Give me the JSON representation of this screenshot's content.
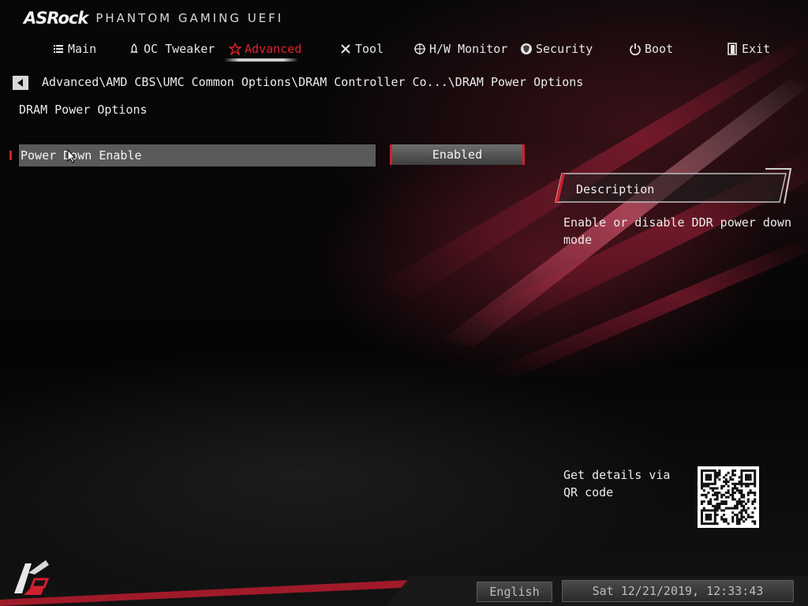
{
  "header": {
    "brand": "ASRock",
    "subtitle": "PHANTOM GAMING UEFI"
  },
  "nav": {
    "tabs": [
      {
        "label": "Main",
        "icon": "list-icon",
        "active": false
      },
      {
        "label": "OC Tweaker",
        "icon": "rocket-icon",
        "active": false
      },
      {
        "label": "Advanced",
        "icon": "star-icon",
        "active": true
      },
      {
        "label": "Tool",
        "icon": "tools-icon",
        "active": false
      },
      {
        "label": "H/W Monitor",
        "icon": "crosshair-icon",
        "active": false
      },
      {
        "label": "Security",
        "icon": "shield-icon",
        "active": false
      },
      {
        "label": "Boot",
        "icon": "power-icon",
        "active": false
      },
      {
        "label": "Exit",
        "icon": "exit-door-icon",
        "active": false
      }
    ]
  },
  "breadcrumb": "Advanced\\AMD CBS\\UMC Common Options\\DRAM Controller Co...\\DRAM Power Options",
  "page_title": "DRAM Power Options",
  "options": [
    {
      "label": "Power Down Enable",
      "value": "Enabled"
    }
  ],
  "description": {
    "title": "Description",
    "text": "Enable or disable DDR power down mode"
  },
  "qr": {
    "text": "Get details via QR code"
  },
  "footer": {
    "language": "English",
    "datetime": "Sat 12/21/2019, 12:33:43"
  },
  "colors": {
    "accent": "#d0202d",
    "background": "#000000",
    "text": "#ececec"
  }
}
